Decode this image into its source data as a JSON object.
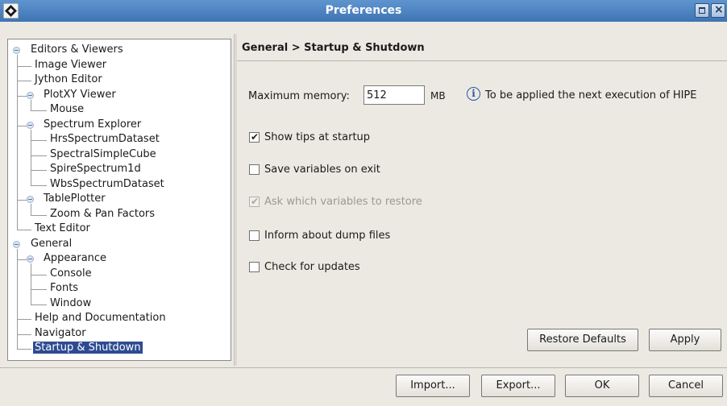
{
  "window": {
    "title": "Preferences"
  },
  "tree": [
    {
      "label": "Editors & Viewers",
      "level": 0,
      "expandable": true
    },
    {
      "label": "Image Viewer",
      "level": 1
    },
    {
      "label": "Jython Editor",
      "level": 1
    },
    {
      "label": "PlotXY Viewer",
      "level": 1,
      "expandable": true
    },
    {
      "label": "Mouse",
      "level": 2
    },
    {
      "label": "Spectrum Explorer",
      "level": 1,
      "expandable": true
    },
    {
      "label": "HrsSpectrumDataset",
      "level": 2
    },
    {
      "label": "SpectralSimpleCube",
      "level": 2
    },
    {
      "label": "SpireSpectrum1d",
      "level": 2
    },
    {
      "label": "WbsSpectrumDataset",
      "level": 2
    },
    {
      "label": "TablePlotter",
      "level": 1,
      "expandable": true
    },
    {
      "label": "Zoom & Pan Factors",
      "level": 2
    },
    {
      "label": "Text Editor",
      "level": 1
    },
    {
      "label": "General",
      "level": 0,
      "expandable": true
    },
    {
      "label": "Appearance",
      "level": 1,
      "expandable": true
    },
    {
      "label": "Console",
      "level": 2
    },
    {
      "label": "Fonts",
      "level": 2
    },
    {
      "label": "Window",
      "level": 2
    },
    {
      "label": "Help and Documentation",
      "level": 1
    },
    {
      "label": "Navigator",
      "level": 1
    },
    {
      "label": "Startup & Shutdown",
      "level": 1,
      "selected": true
    }
  ],
  "panel": {
    "breadcrumb": "General > Startup & Shutdown",
    "memory_label": "Maximum memory:",
    "memory_value": "512",
    "memory_unit": "MB",
    "info_text": "To be applied the next execution of HIPE",
    "options": [
      {
        "label": "Show tips at startup",
        "checked": true,
        "enabled": true
      },
      {
        "label": "Save variables on exit",
        "checked": false,
        "enabled": true
      },
      {
        "label": "Ask which variables to restore",
        "checked": true,
        "enabled": false
      },
      {
        "label": "Inform about dump files",
        "checked": false,
        "enabled": true
      },
      {
        "label": "Check for updates",
        "checked": false,
        "enabled": true
      }
    ],
    "restore_defaults": "Restore Defaults",
    "apply": "Apply"
  },
  "footer": {
    "import": "Import...",
    "export": "Export...",
    "ok": "OK",
    "cancel": "Cancel"
  },
  "colors": {
    "titlebar": "#4a82c0",
    "selection": "#2e4b91"
  }
}
